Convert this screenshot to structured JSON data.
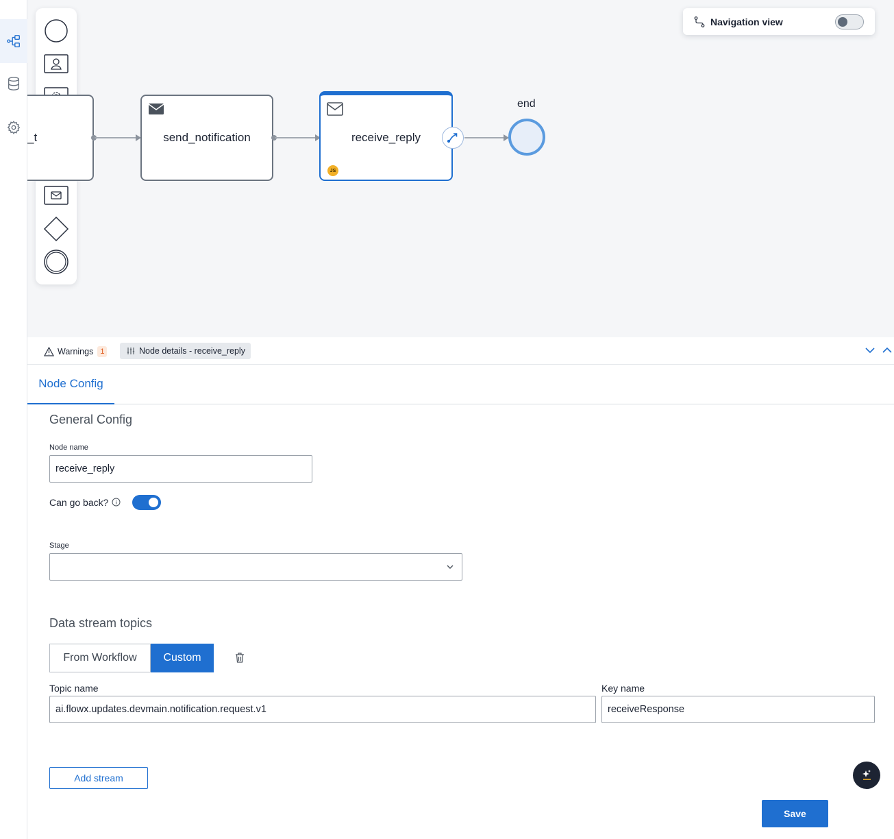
{
  "rail": {
    "items": [
      {
        "icon": "process-flow-icon",
        "active": true
      },
      {
        "icon": "database-icon",
        "active": false
      },
      {
        "icon": "gear-icon",
        "active": false
      }
    ]
  },
  "palette": {
    "items": [
      "start-event-icon",
      "user-task-icon",
      "service-task-icon",
      "subprocess-icon",
      "send-message-icon",
      "receive-message-icon",
      "gateway-icon",
      "end-event-icon"
    ]
  },
  "navigation_view": {
    "label": "Navigation view",
    "enabled": false
  },
  "diagram": {
    "partial_node_label": "_t",
    "nodes": [
      {
        "label": "send_notification",
        "type": "send-message"
      },
      {
        "label": "receive_reply",
        "type": "receive-message",
        "selected": true,
        "badge": "JS"
      }
    ],
    "end_label": "end"
  },
  "panel": {
    "warnings_label": "Warnings",
    "warnings_count": "1",
    "details_tab_label": "Node details - receive_reply",
    "subtab_label": "Node Config"
  },
  "form": {
    "general_config_title": "General Config",
    "node_name_label": "Node name",
    "node_name_value": "receive_reply",
    "can_go_back_label": "Can go back?",
    "can_go_back": true,
    "stage_label": "Stage",
    "stage_value": "",
    "data_stream_title": "Data stream topics",
    "from_workflow_label": "From Workflow",
    "custom_label": "Custom",
    "topic_name_label": "Topic name",
    "topic_name_value": "ai.flowx.updates.devmain.notification.request.v1",
    "key_name_label": "Key name",
    "key_name_value": "receiveResponse",
    "add_stream_label": "Add stream",
    "save_label": "Save"
  },
  "colors": {
    "accent": "#1f6fd0",
    "canvas_bg": "#f5f6f8",
    "warning": "#e05a1c"
  }
}
